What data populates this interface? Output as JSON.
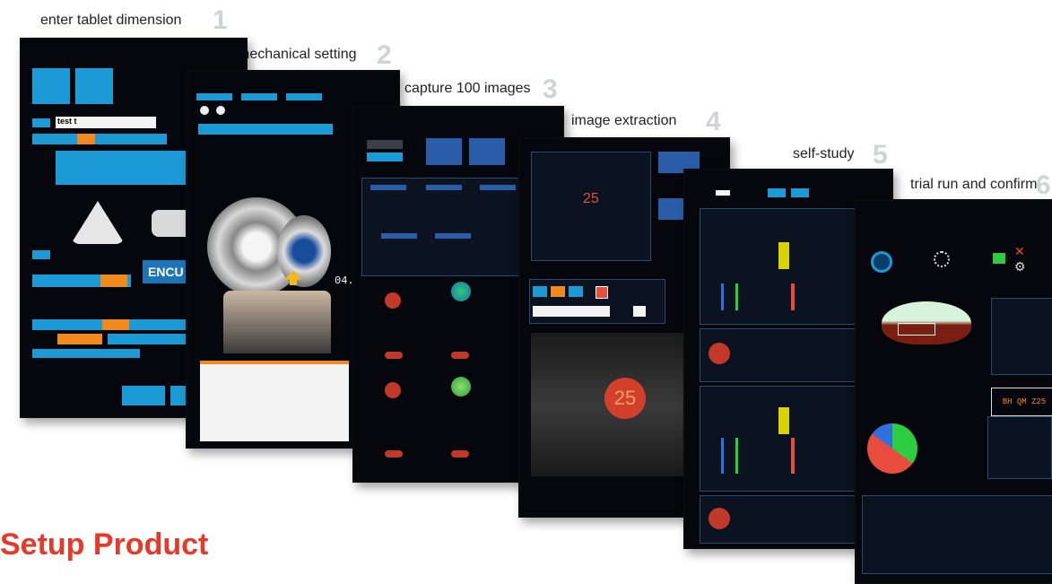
{
  "steps": [
    {
      "label": "enter tablet dimension",
      "num": "1"
    },
    {
      "label": "mechanical setting",
      "num": "2"
    },
    {
      "label": "capture 100 images",
      "num": "3"
    },
    {
      "label": "image extraction",
      "num": "4"
    },
    {
      "label": "self-study",
      "num": "5"
    },
    {
      "label": "trial run and confirm",
      "num": "6"
    }
  ],
  "page_title": "Setup Product",
  "screens": {
    "s1_input": "test t",
    "s1_logo": "ENCU",
    "s2_counter": "04.",
    "s4_counter": "25",
    "s4_token": "25",
    "s6_readout": "BH QM Z25"
  },
  "colors": {
    "accent_cyan": "#1c9ad6",
    "accent_orange": "#f08a1d",
    "title_red": "#e53a2a",
    "step_gray": "#cfd2d6"
  }
}
